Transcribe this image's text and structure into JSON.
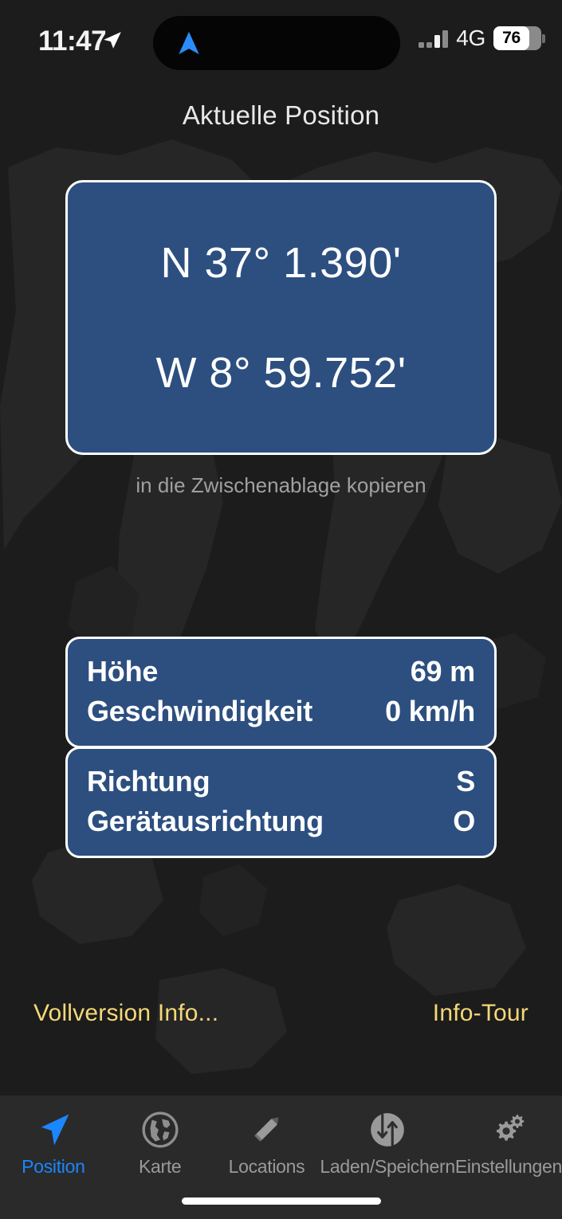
{
  "status_bar": {
    "time": "11:47",
    "location_arrow_icon": "location-arrow-icon",
    "island_arrow_icon": "navigation-arrow-icon",
    "cellular_icon": "cellular-signal-icon",
    "network": "4G",
    "battery_level": "76",
    "battery_icon": "battery-icon"
  },
  "header": {
    "title": "Aktuelle Position"
  },
  "coordinates": {
    "latitude": "N 37° 1.390'",
    "longitude": "W 8° 59.752'",
    "copy_hint": "in die Zwischenablage kopieren"
  },
  "info_cards": [
    {
      "rows": [
        {
          "label": "Höhe",
          "value": "69 m"
        },
        {
          "label": "Geschwindigkeit",
          "value": "0 km/h"
        }
      ]
    },
    {
      "rows": [
        {
          "label": "Richtung",
          "value": "S"
        },
        {
          "label": "Gerätausrichtung",
          "value": "O"
        }
      ]
    }
  ],
  "links": {
    "left": "Vollversion Info...",
    "right": "Info-Tour"
  },
  "tabbar": {
    "items": [
      {
        "label": "Position",
        "icon": "navigation-arrow-icon",
        "active": true
      },
      {
        "label": "Karte",
        "icon": "globe-icon",
        "active": false
      },
      {
        "label": "Locations",
        "icon": "pencil-icon",
        "active": false
      },
      {
        "label": "Laden/Speichern",
        "icon": "load-save-arrows-icon",
        "active": false
      },
      {
        "label": "Einstellungen",
        "icon": "gears-icon",
        "active": false
      }
    ]
  },
  "colors": {
    "card_blue": "#2c4f80",
    "accent_blue": "#1a86ff",
    "link_yellow": "#f5d878",
    "background": "#1c1c1c",
    "tabbar_background": "#2a2a2a"
  }
}
